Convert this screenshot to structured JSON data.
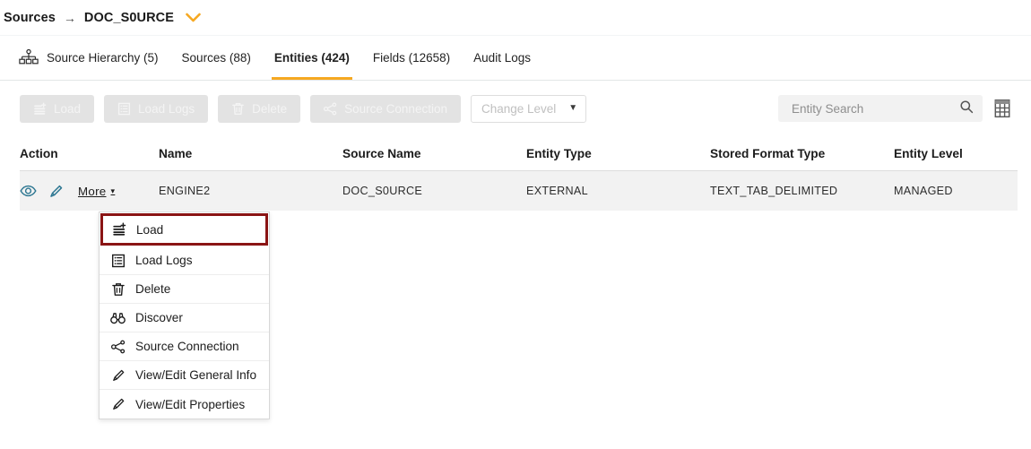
{
  "breadcrumb": {
    "root": "Sources",
    "separator": "→",
    "current": "DOC_S0URCE",
    "caret_icon": "chevron-down-icon",
    "caret_color": "#f6a821"
  },
  "tabs": [
    {
      "label": "Source Hierarchy (5)",
      "icon": "hierarchy-icon",
      "active": false
    },
    {
      "label": "Sources (88)",
      "icon": "",
      "active": false
    },
    {
      "label": "Entities (424)",
      "icon": "",
      "active": true
    },
    {
      "label": "Fields (12658)",
      "icon": "",
      "active": false
    },
    {
      "label": "Audit Logs",
      "icon": "",
      "active": false
    }
  ],
  "toolbar": {
    "buttons": [
      {
        "label": "Load",
        "icon": "load-icon",
        "disabled": true
      },
      {
        "label": "Load Logs",
        "icon": "load-logs-icon",
        "disabled": true
      },
      {
        "label": "Delete",
        "icon": "trash-icon",
        "disabled": true
      },
      {
        "label": "Source Connection",
        "icon": "share-nodes-icon",
        "disabled": true
      }
    ],
    "change_level": {
      "value": "Change Level",
      "caret_icon": "caret-down-icon"
    },
    "search": {
      "placeholder": "Entity Search",
      "value": "",
      "icon": "search-icon"
    },
    "grid_toggle_icon": "table-grid-icon"
  },
  "table": {
    "columns": [
      "Action",
      "Name",
      "Source Name",
      "Entity Type",
      "Stored Format Type",
      "Entity Level"
    ],
    "rows": [
      {
        "actions": {
          "view_icon": "eye-icon",
          "edit_icon": "pencil-icon",
          "more_label": "More",
          "more_caret": "▾"
        },
        "name": "ENGINE2",
        "source_name": "DOC_S0URCE",
        "entity_type": "EXTERNAL",
        "stored_format_type": "TEXT_TAB_DELIMITED",
        "entity_level": "MANAGED"
      }
    ]
  },
  "dropdown": {
    "open": true,
    "highlight_color": "#8a1414",
    "items": [
      {
        "label": "Load",
        "icon": "load-icon",
        "highlighted": true
      },
      {
        "label": "Load Logs",
        "icon": "load-logs-icon",
        "highlighted": false
      },
      {
        "label": "Delete",
        "icon": "trash-icon",
        "highlighted": false
      },
      {
        "label": "Discover",
        "icon": "binoculars-icon",
        "highlighted": false
      },
      {
        "label": "Source Connection",
        "icon": "share-nodes-icon",
        "highlighted": false
      },
      {
        "label": "View/Edit General Info",
        "icon": "pencil-icon",
        "highlighted": false
      },
      {
        "label": "View/Edit Properties",
        "icon": "pencil-icon",
        "highlighted": false
      }
    ]
  },
  "colors": {
    "accent_orange": "#f6a821",
    "icon_blue": "#2c7691",
    "row_bg": "#f2f2f2"
  }
}
